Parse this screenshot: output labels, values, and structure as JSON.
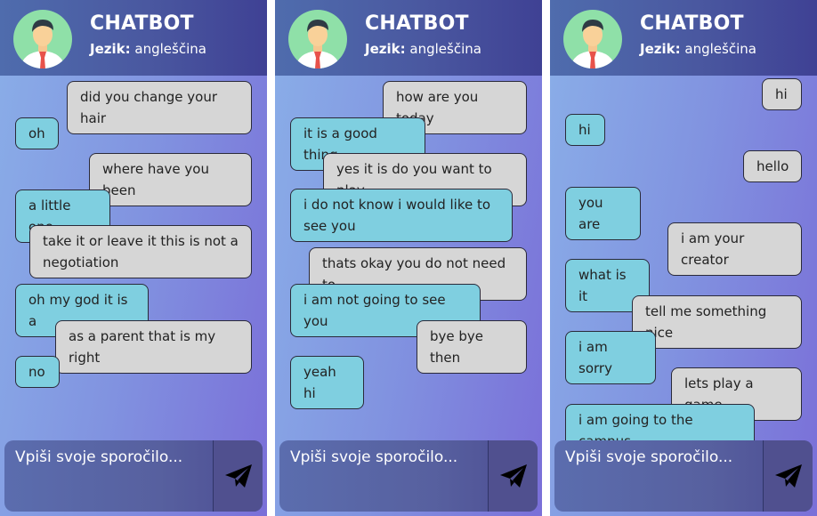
{
  "panels": [
    {
      "header": {
        "title": "CHATBOT",
        "lang_label": "Jezik:",
        "lang_value": "angleščina"
      },
      "input": {
        "placeholder": "Vpiši svoje sporočilo..."
      },
      "messages": [
        {
          "text": "did you change your hair",
          "from": "user"
        },
        {
          "text": "oh",
          "from": "bot"
        },
        {
          "text": "where have you been",
          "from": "user"
        },
        {
          "text": "a little one",
          "from": "bot"
        },
        {
          "text": "take it or leave it this is not a negotiation",
          "from": "user"
        },
        {
          "text": "oh my god it is a",
          "from": "bot"
        },
        {
          "text": "as a parent that is my right",
          "from": "user"
        },
        {
          "text": "no",
          "from": "bot"
        }
      ]
    },
    {
      "header": {
        "title": "CHATBOT",
        "lang_label": "Jezik:",
        "lang_value": "angleščina"
      },
      "input": {
        "placeholder": "Vpiši svoje sporočilo..."
      },
      "messages": [
        {
          "text": "how are you today",
          "from": "user"
        },
        {
          "text": "it is a good thing",
          "from": "bot"
        },
        {
          "text": "yes it is do you want to play",
          "from": "user"
        },
        {
          "text": "i do not know i would like to see you",
          "from": "bot"
        },
        {
          "text": "thats okay you do not need to",
          "from": "user"
        },
        {
          "text": "i am not going to see you",
          "from": "bot"
        },
        {
          "text": "bye bye then",
          "from": "user"
        },
        {
          "text": "yeah hi",
          "from": "bot"
        }
      ]
    },
    {
      "header": {
        "title": "CHATBOT",
        "lang_label": "Jezik:",
        "lang_value": "angleščina"
      },
      "input": {
        "placeholder": "Vpiši svoje sporočilo..."
      },
      "messages": [
        {
          "text": "hi",
          "from": "user"
        },
        {
          "text": "hi",
          "from": "bot"
        },
        {
          "text": "hello",
          "from": "user"
        },
        {
          "text": "you are",
          "from": "bot"
        },
        {
          "text": "i am your creator",
          "from": "user"
        },
        {
          "text": "what is it",
          "from": "bot"
        },
        {
          "text": "tell me something nice",
          "from": "user"
        },
        {
          "text": "i am sorry",
          "from": "bot"
        },
        {
          "text": "lets play a game",
          "from": "user"
        },
        {
          "text": "i am going to the campus",
          "from": "bot"
        }
      ]
    }
  ],
  "colors": {
    "bot_bubble": "#7fcfe0",
    "user_bubble": "#d6d6d6",
    "header": "#4a58a0"
  },
  "icons": {
    "avatar": "bot-avatar-icon",
    "send": "paper-plane-icon"
  }
}
